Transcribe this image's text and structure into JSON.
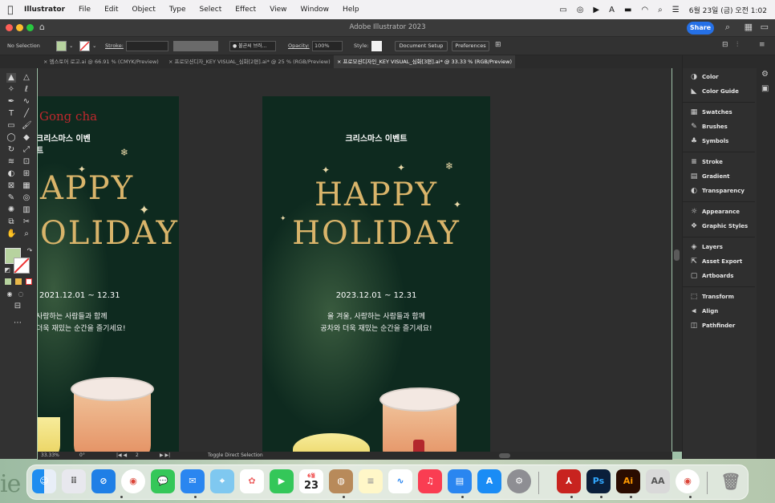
{
  "menubar": {
    "app": "Illustrator",
    "items": [
      "File",
      "Edit",
      "Object",
      "Type",
      "Select",
      "Effect",
      "View",
      "Window",
      "Help"
    ],
    "datetime": "6월 23일 (금) 오전 1:02"
  },
  "window": {
    "title": "Adobe Illustrator 2023",
    "share_label": "Share"
  },
  "control": {
    "selection": "No Selection",
    "stroke_label": "Stroke:",
    "brush_value": "● 불균씨 브러...",
    "opacity_label": "Opacity:",
    "opacity_value": "100%",
    "style_label": "Style:",
    "document_setup": "Document Setup",
    "preferences": "Preferences"
  },
  "tabs": [
    "엠스토어 로고.ai @ 66.91 % (CMYK/Preview)",
    "프로모션디자_KEY VISUAL_심화[2편].ai* @ 25 % (RGB/Preview)",
    "프로모션디자인_KEY VISUAL_심화[3편].ai* @ 33.33 % (RGB/Preview)"
  ],
  "artboard_left": {
    "brand": "Gong cha",
    "event": "크리스마스 이벤트",
    "line1": "APPY",
    "line2": "OLIDAY",
    "date": "2021.12.01 ~ 12.31",
    "msg1": "사랑하는 사람들과 함께",
    "msg2": "더욱 재밌는 순간을 즐기세요!"
  },
  "artboard_right": {
    "event": "크리스마스 이벤트",
    "line1": "HAPPY",
    "line2": "HOLIDAY",
    "date": "2023.12.01 ~ 12.31",
    "msg1": "올 겨울, 사랑하는 사람들과 함께",
    "msg2": "공차와 더욱 재밌는 순간을 즐기세요!"
  },
  "panels": [
    {
      "icon": "color-icon",
      "label": "Color",
      "group": 1
    },
    {
      "icon": "color-guide-icon",
      "label": "Color Guide",
      "group": 1
    },
    {
      "icon": "swatches-icon",
      "label": "Swatches",
      "group": 2
    },
    {
      "icon": "brushes-icon",
      "label": "Brushes",
      "group": 2
    },
    {
      "icon": "symbols-icon",
      "label": "Symbols",
      "group": 2
    },
    {
      "icon": "stroke-icon",
      "label": "Stroke",
      "group": 3
    },
    {
      "icon": "gradient-icon",
      "label": "Gradient",
      "group": 3
    },
    {
      "icon": "transparency-icon",
      "label": "Transparency",
      "group": 3
    },
    {
      "icon": "appearance-icon",
      "label": "Appearance",
      "group": 4
    },
    {
      "icon": "graphic-styles-icon",
      "label": "Graphic Styles",
      "group": 4
    },
    {
      "icon": "layers-icon",
      "label": "Layers",
      "group": 5
    },
    {
      "icon": "asset-export-icon",
      "label": "Asset Export",
      "group": 5
    },
    {
      "icon": "artboards-icon",
      "label": "Artboards",
      "group": 5
    },
    {
      "icon": "transform-icon",
      "label": "Transform",
      "group": 6
    },
    {
      "icon": "align-icon",
      "label": "Align",
      "group": 6
    },
    {
      "icon": "pathfinder-icon",
      "label": "Pathfinder",
      "group": 6
    }
  ],
  "status": {
    "zoom": "33.33%",
    "rotate": "0°",
    "artboard_num": "2",
    "hint": "Toggle Direct Selection"
  },
  "dock": {
    "calendar_month": "6월",
    "calendar_day": "23",
    "apps": [
      "Finder",
      "Launchpad",
      "Safari",
      "Chrome",
      "Messages",
      "Mail",
      "Maps",
      "Photos",
      "FaceTime",
      "Calendar",
      "Contacts",
      "Notes",
      "Freeform",
      "Music",
      "Keynote",
      "App Store",
      "System Settings",
      "Acrobat",
      "Photoshop",
      "Illustrator",
      "Font Book",
      "Chrome",
      "Trash"
    ]
  },
  "colors": {
    "fill_swatch": "#b7d39f",
    "artboard_bg": "#0e2a1f",
    "gold": "#d9b46a",
    "share": "#2570e6"
  }
}
